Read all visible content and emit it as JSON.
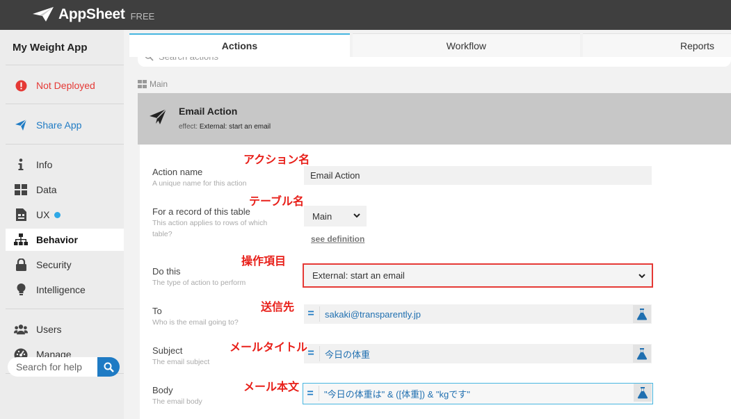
{
  "header": {
    "brand": "AppSheet",
    "plan": "FREE"
  },
  "sidebar": {
    "app_name": "My Weight App",
    "status": "Not Deployed",
    "share": "Share App",
    "items": [
      {
        "label": "Info",
        "icon": "info-icon"
      },
      {
        "label": "Data",
        "icon": "data-grid-icon"
      },
      {
        "label": "UX",
        "icon": "ux-icon"
      },
      {
        "label": "Behavior",
        "icon": "sitemap-icon"
      },
      {
        "label": "Security",
        "icon": "lock-icon"
      },
      {
        "label": "Intelligence",
        "icon": "lightbulb-icon"
      }
    ],
    "items2": [
      {
        "label": "Users",
        "icon": "users-icon"
      },
      {
        "label": "Manage",
        "icon": "gauge-icon"
      }
    ],
    "search_placeholder": "Search for help",
    "active_item": "Behavior"
  },
  "tabs": [
    {
      "label": "Actions"
    },
    {
      "label": "Workflow"
    },
    {
      "label": "Reports"
    }
  ],
  "actions_search": {
    "placeholder": "Search actions"
  },
  "section": {
    "label": "Main"
  },
  "action": {
    "title": "Email Action",
    "effect_prefix": "effect:",
    "effect": "External: start an email"
  },
  "form": {
    "action_name": {
      "label": "Action name",
      "hint": "A unique name for this action",
      "value": "Email Action"
    },
    "table": {
      "label": "For a record of this table",
      "hint": "This action applies to rows of which table?",
      "value": "Main",
      "see_definition": "see definition"
    },
    "do_this": {
      "label": "Do this",
      "hint": "The type of action to perform",
      "value": "External: start an email"
    },
    "to": {
      "label": "To",
      "hint": "Who is the email going to?",
      "value": "sakaki@transparently.jp"
    },
    "subject": {
      "label": "Subject",
      "hint": "The email subject",
      "value": "今日の体重"
    },
    "body": {
      "label": "Body",
      "hint": "The email body",
      "value": "\"今日の体重は\" & ([体重]) & \"kgです\""
    }
  },
  "annotations": {
    "action_name": "アクション名",
    "table": "テーブル名",
    "operation": "操作項目",
    "to": "送信先",
    "subject": "メールタイトル",
    "body": "メール本文"
  },
  "colors": {
    "accent": "#1f7bc4",
    "highlight": "#e53935",
    "tab_active": "#45b5e0",
    "annotation": "#e8201a"
  }
}
